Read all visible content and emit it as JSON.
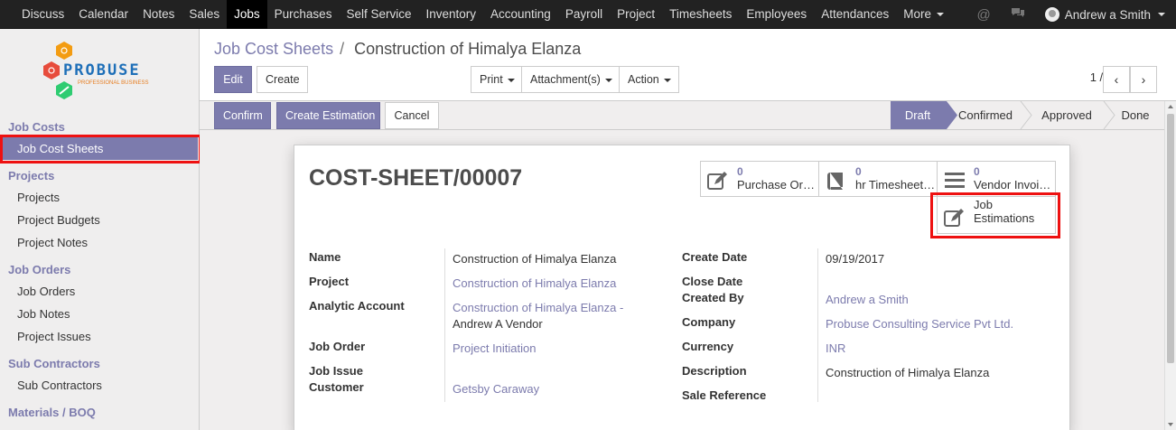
{
  "topnav": {
    "items": [
      "Discuss",
      "Calendar",
      "Notes",
      "Sales",
      "Jobs",
      "Purchases",
      "Self Service",
      "Inventory",
      "Accounting",
      "Payroll",
      "Project",
      "Timesheets",
      "Employees",
      "Attendances",
      "More"
    ],
    "active": "Jobs",
    "user": "Andrew a Smith"
  },
  "sidebar": {
    "logo_text": "PROBUSE",
    "logo_sub": "PROFESSIONAL BUSINESS",
    "sections": [
      {
        "header": "Job Costs",
        "items": [
          "Job Cost Sheets"
        ]
      },
      {
        "header": "Projects",
        "items": [
          "Projects",
          "Project Budgets",
          "Project Notes"
        ]
      },
      {
        "header": "Job Orders",
        "items": [
          "Job Orders",
          "Job Notes",
          "Project Issues"
        ]
      },
      {
        "header": "Sub Contractors",
        "items": [
          "Sub Contractors"
        ]
      },
      {
        "header": "Materials / BOQ",
        "items": []
      }
    ]
  },
  "breadcrumb": {
    "parent": "Job Cost Sheets",
    "separator": "/",
    "current": "Construction of Himalya Elanza"
  },
  "actions": {
    "edit": "Edit",
    "create": "Create",
    "print": "Print",
    "attachments": "Attachment(s)",
    "action": "Action"
  },
  "pager": {
    "value": "1 / 1",
    "prev": "‹",
    "next": "›"
  },
  "statusbar": {
    "buttons": {
      "confirm": "Confirm",
      "create_estimation": "Create Estimation",
      "cancel": "Cancel"
    },
    "stages": [
      "Draft",
      "Confirmed",
      "Approved",
      "Done"
    ],
    "active_stage": "Draft"
  },
  "sheet": {
    "title": "COST-SHEET/00007",
    "smart_buttons": [
      {
        "count": "0",
        "label": "Purchase Or…",
        "icon": "edit-icon"
      },
      {
        "count": "0",
        "label": "hr Timesheet…",
        "icon": "book-icon"
      },
      {
        "count": "0",
        "label": "Vendor Invoi…",
        "icon": "list-icon"
      },
      {
        "count": "",
        "label": "Job Estimations",
        "label_line1": "Job",
        "label_line2": "Estimations",
        "icon": "edit-icon"
      }
    ],
    "left_fields": {
      "name_label": "Name",
      "name": "Construction of Himalya Elanza",
      "project_label": "Project",
      "project": "Construction of Himalya Elanza",
      "analytic_label": "Analytic Account",
      "analytic_line1": "Construction of Himalya Elanza -",
      "analytic_line2": "Andrew A Vendor",
      "job_order_label": "Job Order",
      "job_order": "Project Initiation",
      "job_issue_label": "Job Issue",
      "job_issue": "",
      "customer_label": "Customer",
      "customer": "Getsby Caraway"
    },
    "right_fields": {
      "create_date_label": "Create Date",
      "create_date": "09/19/2017",
      "close_date_label": "Close Date",
      "close_date": "",
      "created_by_label": "Created By",
      "created_by": "Andrew a Smith",
      "company_label": "Company",
      "company": "Probuse Consulting Service Pvt Ltd.",
      "currency_label": "Currency",
      "currency": "INR",
      "description_label": "Description",
      "description": "Construction of Himalya Elanza",
      "sale_ref_label": "Sale Reference",
      "sale_ref": ""
    }
  },
  "colors": {
    "brand": "#7c7bad",
    "highlight": "#e11111",
    "topbar": "#222222"
  }
}
